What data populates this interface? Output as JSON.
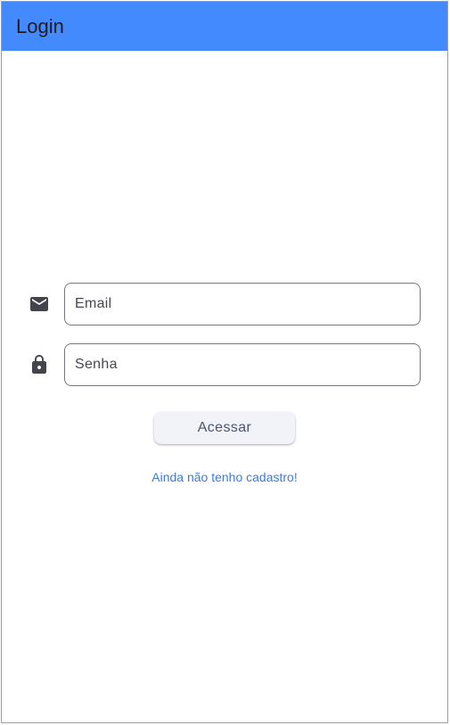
{
  "appbar": {
    "title": "Login",
    "background": "#448aff"
  },
  "form": {
    "email": {
      "icon": "mail-icon",
      "placeholder": "Email",
      "value": ""
    },
    "password": {
      "icon": "lock-icon",
      "placeholder": "Senha",
      "value": ""
    },
    "submit_label": "Acessar",
    "register_link": "Ainda não tenho cadastro!"
  },
  "colors": {
    "link": "#3a7be0",
    "icon": "#44444c",
    "field_border": "#79747e",
    "button_background": "#f2f3f8"
  }
}
